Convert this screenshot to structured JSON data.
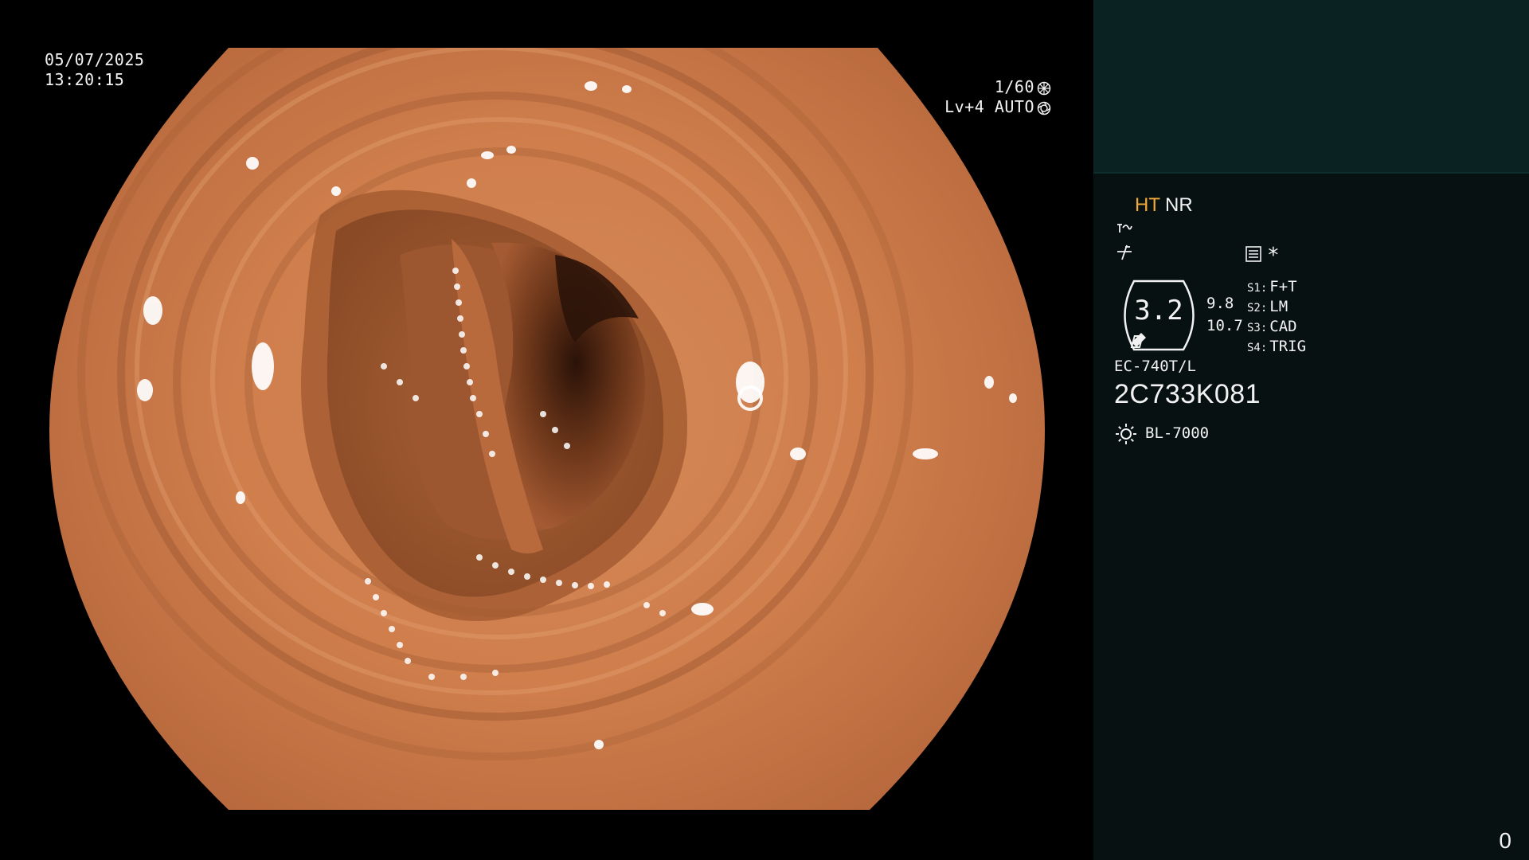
{
  "osd": {
    "date": "05/07/2025",
    "time": "13:20:15",
    "shutter": "1/60",
    "iris": "Lv+4 AUTO"
  },
  "panel": {
    "mode_ht": "HT",
    "mode_nr": "NR",
    "star": "*",
    "zoom": "3.2",
    "value_top": "9.8",
    "value_bottom": "10.7",
    "slots": [
      {
        "key": "S1:",
        "value": "F+T"
      },
      {
        "key": "S2:",
        "value": "LM"
      },
      {
        "key": "S3:",
        "value": "CAD"
      },
      {
        "key": "S4:",
        "value": "TRIG"
      }
    ],
    "scope_model": "EC-740T/L",
    "scope_serial": "2C733K081",
    "light_source": "BL-7000",
    "counter": "0"
  },
  "icons": {
    "shutter": "aperture-icon",
    "iris": "iris-icon",
    "enhancement": "enhancement-icon",
    "frequency": "frequency-icon",
    "memo": "memo-icon",
    "light": "sun-icon",
    "zoom_badge": "zoom-badge-icon"
  },
  "colors": {
    "panel_header": "#0a2322",
    "panel_body": "#071111",
    "accent_ht": "#f2a93b",
    "tissue": "#c87848"
  }
}
